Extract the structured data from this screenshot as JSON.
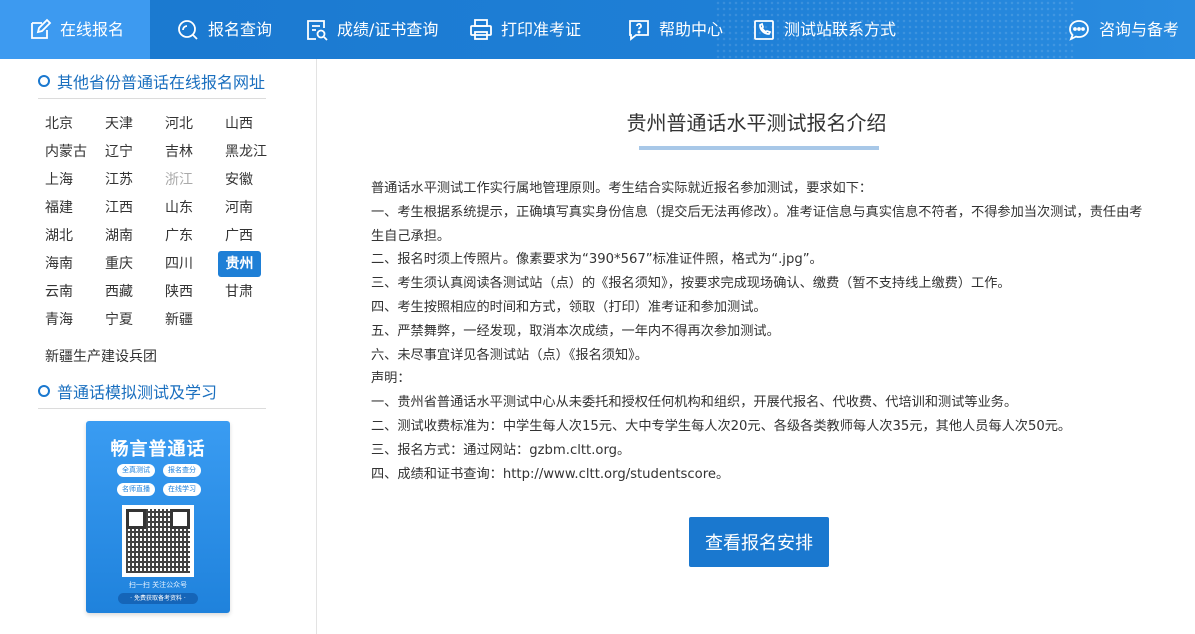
{
  "nav": {
    "items": [
      {
        "label": "在线报名",
        "icon": "edit-icon",
        "active": true
      },
      {
        "label": "报名查询",
        "icon": "search-icon"
      },
      {
        "label": "成绩/证书查询",
        "icon": "certificate-search-icon"
      },
      {
        "label": "打印准考证",
        "icon": "printer-icon"
      },
      {
        "label": "帮助中心",
        "icon": "help-icon"
      },
      {
        "label": "测试站联系方式",
        "icon": "phone-icon"
      },
      {
        "label": "咨询与备考",
        "icon": "chat-icon"
      }
    ]
  },
  "sidebar": {
    "provinces_title": "其他省份普通话在线报名网址",
    "provinces": [
      {
        "name": "北京"
      },
      {
        "name": "天津"
      },
      {
        "name": "河北"
      },
      {
        "name": "山西"
      },
      {
        "name": "内蒙古"
      },
      {
        "name": "辽宁"
      },
      {
        "name": "吉林"
      },
      {
        "name": "黑龙江"
      },
      {
        "name": "上海"
      },
      {
        "name": "江苏"
      },
      {
        "name": "浙江",
        "disabled": true
      },
      {
        "name": "安徽"
      },
      {
        "name": "福建"
      },
      {
        "name": "江西"
      },
      {
        "name": "山东"
      },
      {
        "name": "河南"
      },
      {
        "name": "湖北"
      },
      {
        "name": "湖南"
      },
      {
        "name": "广东"
      },
      {
        "name": "广西"
      },
      {
        "name": "海南"
      },
      {
        "name": "重庆"
      },
      {
        "name": "四川"
      },
      {
        "name": "贵州",
        "active": true
      },
      {
        "name": "云南"
      },
      {
        "name": "西藏"
      },
      {
        "name": "陕西"
      },
      {
        "name": "甘肃"
      },
      {
        "name": "青海"
      },
      {
        "name": "宁夏"
      },
      {
        "name": "新疆"
      }
    ],
    "extra_item": "新疆生产建设兵团",
    "study_title": "普通话模拟测试及学习",
    "promo": {
      "title": "畅言普通话",
      "tags": [
        "全真测试",
        "报名查分",
        "名师直播",
        "在线学习"
      ],
      "scan_text": "扫一扫 关注公众号",
      "free_text": "· 免费获取备考资料 ·"
    }
  },
  "main": {
    "title": "贵州普通话水平测试报名介绍",
    "paragraphs": [
      "普通话水平测试工作实行属地管理原则。考生结合实际就近报名参加测试，要求如下：",
      "一、考生根据系统提示，正确填写真实身份信息（提交后无法再修改）。准考证信息与真实信息不符者，不得参加当次测试，责任由考生自己承担。",
      "二、报名时须上传照片。像素要求为“390*567”标准证件照，格式为“.jpg”。",
      "三、考生须认真阅读各测试站（点）的《报名须知》，按要求完成现场确认、缴费（暂不支持线上缴费）工作。",
      "四、考生按照相应的时间和方式，领取（打印）准考证和参加测试。",
      "五、严禁舞弊，一经发现，取消本次成绩，一年内不得再次参加测试。",
      "六、未尽事宜详见各测试站（点）《报名须知》。",
      "声明：",
      "一、贵州省普通话水平测试中心从未委托和授权任何机构和组织，开展代报名、代收费、代培训和测试等业务。",
      "二、测试收费标准为：中学生每人次15元、大中专学生每人次20元、各级各类教师每人次35元，其他人员每人次50元。",
      "三、报名方式：通过网站：gzbm.cltt.org。",
      "四、成绩和证书查询：http://www.cltt.org/studentscore。"
    ],
    "button_label": "查看报名安排"
  },
  "colors": {
    "nav_bg": "#1e7fd6",
    "nav_active": "#3d9af0",
    "accent": "#1a78cf",
    "province_active": "#1e7fd6",
    "disabled_text": "#aaaaaa"
  }
}
